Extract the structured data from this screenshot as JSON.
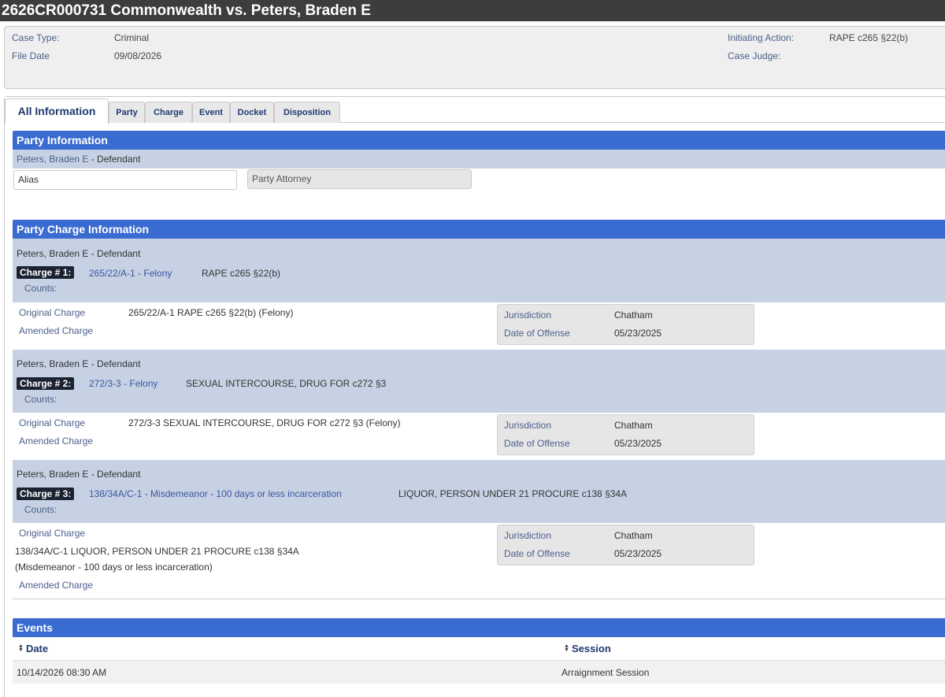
{
  "title": "2626CR000731 Commonwealth vs. Peters, Braden E",
  "case_header": {
    "case_type_label": "Case Type:",
    "case_type": "Criminal",
    "file_date_label": "File Date",
    "file_date": "09/08/2026",
    "initiating_action_label": "Initiating Action:",
    "initiating_action": "RAPE c265 §22(b)",
    "case_judge_label": "Case Judge:",
    "case_judge": ""
  },
  "tabs": [
    {
      "label": "All Information",
      "active": true
    },
    {
      "label": "Party"
    },
    {
      "label": "Charge"
    },
    {
      "label": "Event"
    },
    {
      "label": "Docket"
    },
    {
      "label": "Disposition"
    }
  ],
  "party_info": {
    "heading": "Party Information",
    "party_name": "Peters, Braden E",
    "party_role": " - Defendant",
    "alias_label": "Alias",
    "attorney_label": "Party Attorney"
  },
  "charge_info": {
    "heading": "Party Charge Information",
    "counts_label": "Counts:",
    "original_label": "Original Charge",
    "amended_label": "Amended Charge",
    "jurisdiction_label": "Jurisdiction",
    "offense_date_label": "Date of Offense",
    "charges": [
      {
        "party": "Peters, Braden E - Defendant",
        "badge": "Charge # 1:",
        "code": "265/22/A-1 - Felony",
        "desc": "RAPE c265 §22(b)",
        "original": "265/22/A-1 RAPE c265 §22(b) (Felony)",
        "jurisdiction": "Chatham",
        "offense_date": "05/23/2025"
      },
      {
        "party": "Peters, Braden E - Defendant",
        "badge": "Charge # 2:",
        "code": "272/3-3 - Felony",
        "desc": "SEXUAL INTERCOURSE, DRUG FOR c272 §3",
        "original": "272/3-3 SEXUAL INTERCOURSE, DRUG FOR c272 §3 (Felony)",
        "jurisdiction": "Chatham",
        "offense_date": "05/23/2025"
      },
      {
        "party": "Peters, Braden E - Defendant",
        "badge": "Charge # 3:",
        "code": "138/34A/C-1 - Misdemeanor - 100 days or less incarceration",
        "desc": "LIQUOR, PERSON UNDER 21 PROCURE c138 §34A",
        "original_line1": "138/34A/C-1 LIQUOR, PERSON UNDER 21 PROCURE c138 §34A",
        "original_line2": "(Misdemeanor - 100 days or less incarceration)",
        "jurisdiction": "Chatham",
        "offense_date": "05/23/2025"
      }
    ]
  },
  "events": {
    "heading": "Events",
    "col_date": "Date",
    "col_session": "Session",
    "sort_icon": "sort-arrows-icon",
    "rows": [
      {
        "date": "10/14/2026 08:30 AM",
        "session": "Arraignment Session"
      }
    ]
  }
}
